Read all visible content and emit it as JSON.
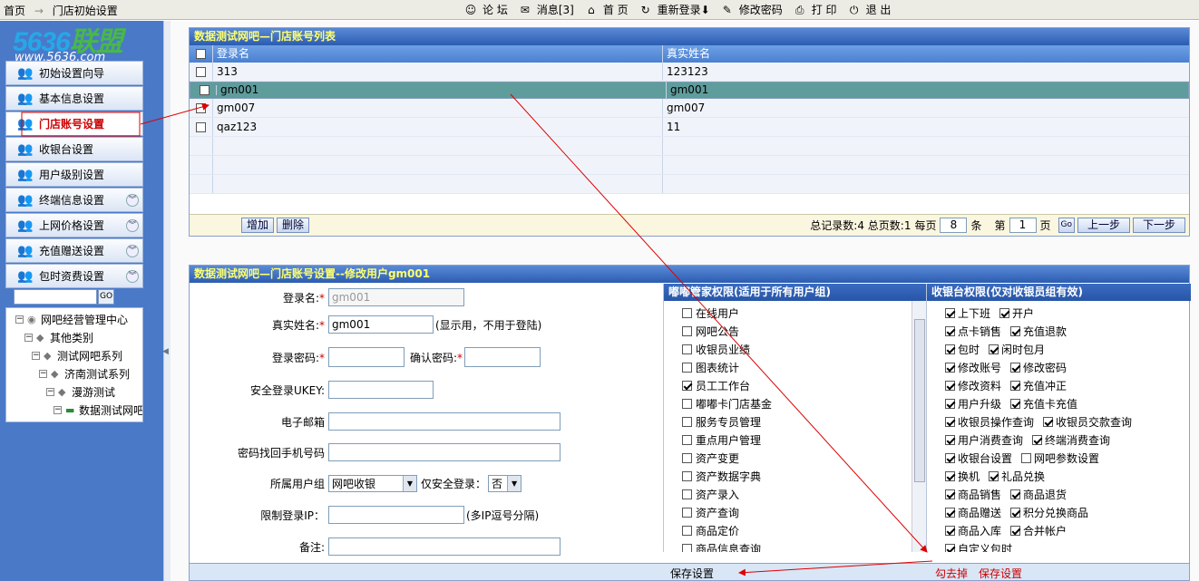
{
  "breadcrumb": {
    "home": "首页",
    "arrow": "→",
    "current": "门店初始设置"
  },
  "toolbar": [
    {
      "icon": "forum-icon",
      "glyph": "☺",
      "label": "论 坛"
    },
    {
      "icon": "message-icon",
      "glyph": "✉",
      "label": "消息[3]"
    },
    {
      "icon": "home-icon",
      "glyph": "⌂",
      "label": "首 页"
    },
    {
      "icon": "relogin-icon",
      "glyph": "↻",
      "label": "重新登录⬇"
    },
    {
      "icon": "password-icon",
      "glyph": "✎",
      "label": "修改密码"
    },
    {
      "icon": "print-icon",
      "glyph": "⎙",
      "label": "打 印"
    },
    {
      "icon": "exit-icon",
      "glyph": "⏻",
      "label": "退 出"
    }
  ],
  "logo": {
    "text_a": "5636",
    "text_b": "联盟",
    "url": "www.5636.com"
  },
  "sidebar": {
    "items": [
      {
        "label": "初始设置向导",
        "chevron": false
      },
      {
        "label": "基本信息设置",
        "chevron": false
      },
      {
        "label": "门店账号设置",
        "chevron": false,
        "active": true
      },
      {
        "label": "收银台设置",
        "chevron": false
      },
      {
        "label": "用户级别设置",
        "chevron": false
      },
      {
        "label": "终端信息设置",
        "chevron": true
      },
      {
        "label": "上网价格设置",
        "chevron": true
      },
      {
        "label": "充值赠送设置",
        "chevron": true
      },
      {
        "label": "包时资费设置",
        "chevron": true
      }
    ],
    "search_go": "GO",
    "tree": [
      "网吧经营管理中心",
      "其他类别",
      "测试网吧系列",
      "济南测试系列",
      "漫游测试",
      "数据测试网吧"
    ]
  },
  "list_panel": {
    "title": "数据测试网吧—门店账号列表",
    "columns": [
      "登录名",
      "真实姓名"
    ],
    "rows": [
      {
        "login": "313",
        "name": "123123"
      },
      {
        "login": "gm001",
        "name": "gm001",
        "selected": true
      },
      {
        "login": "gm007",
        "name": "gm007"
      },
      {
        "login": "qaz123",
        "name": "11"
      }
    ],
    "add": "增加",
    "delete": "删除",
    "pager": {
      "total_label": "总记录数:4 总页数:1",
      "per_page_label": "每页",
      "per_page": "8",
      "unit": "条",
      "page_label": "第",
      "page": "1",
      "page_unit": "页",
      "go": "Go",
      "prev": "上一步",
      "next": "下一步"
    }
  },
  "edit_panel": {
    "title": "数据测试网吧—门店账号设置--修改用户gm001",
    "login_label": "登录名:",
    "login_value": "gm001",
    "realname_label": "真实姓名:",
    "realname_value": "gm001",
    "realname_hint": "(显示用，不用于登陆)",
    "password_label": "登录密码:",
    "confirm_label": "确认密码:",
    "ukey_label": "安全登录UKEY:",
    "email_label": "电子邮箱",
    "phone_label": "密码找回手机号码",
    "group_label": "所属用户组",
    "group_value": "网吧收银",
    "safe_only_label": "仅安全登录：",
    "safe_only_value": "否",
    "ip_label": "限制登录IP：",
    "ip_hint": "(多IP逗号分隔)",
    "note_label": "备注:",
    "manager_head": "嘟嘟管家权限(适用于所有用户组)",
    "manager_perms": [
      {
        "label": "在线用户",
        "on": false
      },
      {
        "label": "网吧公告",
        "on": false
      },
      {
        "label": "收银员业绩",
        "on": false
      },
      {
        "label": "图表统计",
        "on": false
      },
      {
        "label": "员工工作台",
        "on": true
      },
      {
        "label": "嘟嘟卡门店基金",
        "on": false
      },
      {
        "label": "服务专员管理",
        "on": false
      },
      {
        "label": "重点用户管理",
        "on": false
      },
      {
        "label": "资产变更",
        "on": false
      },
      {
        "label": "资产数据字典",
        "on": false
      },
      {
        "label": "资产录入",
        "on": false
      },
      {
        "label": "资产查询",
        "on": false
      },
      {
        "label": "商品定价",
        "on": false
      },
      {
        "label": "商品信息查询",
        "on": false
      }
    ],
    "cashier_head": "收银台权限(仅对收银员组有效)",
    "cashier_perms": [
      [
        {
          "label": "上下班",
          "on": true
        },
        {
          "label": "开户",
          "on": true
        }
      ],
      [
        {
          "label": "点卡销售",
          "on": true
        },
        {
          "label": "充值退款",
          "on": true
        }
      ],
      [
        {
          "label": "包时",
          "on": true
        },
        {
          "label": "闲时包月",
          "on": true
        }
      ],
      [
        {
          "label": "修改账号",
          "on": true
        },
        {
          "label": "修改密码",
          "on": true
        }
      ],
      [
        {
          "label": "修改资料",
          "on": true
        },
        {
          "label": "充值冲正",
          "on": true
        }
      ],
      [
        {
          "label": "用户升级",
          "on": true
        },
        {
          "label": "充值卡充值",
          "on": true
        }
      ],
      [
        {
          "label": "收银员操作查询",
          "on": true
        },
        {
          "label": "收银员交款查询",
          "on": true
        }
      ],
      [
        {
          "label": "用户消费查询",
          "on": true
        },
        {
          "label": "终端消费查询",
          "on": true
        }
      ],
      [
        {
          "label": "收银台设置",
          "on": true
        },
        {
          "label": "网吧参数设置",
          "on": false
        }
      ],
      [
        {
          "label": "换机",
          "on": true
        },
        {
          "label": "礼品兑换",
          "on": true
        }
      ],
      [
        {
          "label": "商品销售",
          "on": true
        },
        {
          "label": "商品退货",
          "on": true
        }
      ],
      [
        {
          "label": "商品赠送",
          "on": true
        },
        {
          "label": "积分兑换商品",
          "on": true
        }
      ],
      [
        {
          "label": "商品入库",
          "on": true
        },
        {
          "label": "合并帐户",
          "on": true
        }
      ],
      [
        {
          "label": "自定义包时",
          "on": true
        }
      ]
    ],
    "save": "保存设置",
    "uncheck": "勾去掉",
    "save2": "保存设置"
  }
}
